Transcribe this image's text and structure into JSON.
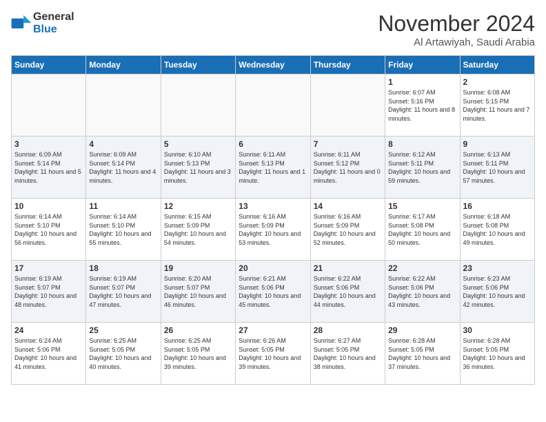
{
  "logo": {
    "text_general": "General",
    "text_blue": "Blue"
  },
  "title": "November 2024",
  "location": "Al Artawiyah, Saudi Arabia",
  "weekdays": [
    "Sunday",
    "Monday",
    "Tuesday",
    "Wednesday",
    "Thursday",
    "Friday",
    "Saturday"
  ],
  "weeks": [
    [
      {
        "day": "",
        "info": ""
      },
      {
        "day": "",
        "info": ""
      },
      {
        "day": "",
        "info": ""
      },
      {
        "day": "",
        "info": ""
      },
      {
        "day": "",
        "info": ""
      },
      {
        "day": "1",
        "info": "Sunrise: 6:07 AM\nSunset: 5:16 PM\nDaylight: 11 hours and 8 minutes."
      },
      {
        "day": "2",
        "info": "Sunrise: 6:08 AM\nSunset: 5:15 PM\nDaylight: 11 hours and 7 minutes."
      }
    ],
    [
      {
        "day": "3",
        "info": "Sunrise: 6:09 AM\nSunset: 5:14 PM\nDaylight: 11 hours and 5 minutes."
      },
      {
        "day": "4",
        "info": "Sunrise: 6:09 AM\nSunset: 5:14 PM\nDaylight: 11 hours and 4 minutes."
      },
      {
        "day": "5",
        "info": "Sunrise: 6:10 AM\nSunset: 5:13 PM\nDaylight: 11 hours and 3 minutes."
      },
      {
        "day": "6",
        "info": "Sunrise: 6:11 AM\nSunset: 5:13 PM\nDaylight: 11 hours and 1 minute."
      },
      {
        "day": "7",
        "info": "Sunrise: 6:11 AM\nSunset: 5:12 PM\nDaylight: 11 hours and 0 minutes."
      },
      {
        "day": "8",
        "info": "Sunrise: 6:12 AM\nSunset: 5:11 PM\nDaylight: 10 hours and 59 minutes."
      },
      {
        "day": "9",
        "info": "Sunrise: 6:13 AM\nSunset: 5:11 PM\nDaylight: 10 hours and 57 minutes."
      }
    ],
    [
      {
        "day": "10",
        "info": "Sunrise: 6:14 AM\nSunset: 5:10 PM\nDaylight: 10 hours and 56 minutes."
      },
      {
        "day": "11",
        "info": "Sunrise: 6:14 AM\nSunset: 5:10 PM\nDaylight: 10 hours and 55 minutes."
      },
      {
        "day": "12",
        "info": "Sunrise: 6:15 AM\nSunset: 5:09 PM\nDaylight: 10 hours and 54 minutes."
      },
      {
        "day": "13",
        "info": "Sunrise: 6:16 AM\nSunset: 5:09 PM\nDaylight: 10 hours and 53 minutes."
      },
      {
        "day": "14",
        "info": "Sunrise: 6:16 AM\nSunset: 5:09 PM\nDaylight: 10 hours and 52 minutes."
      },
      {
        "day": "15",
        "info": "Sunrise: 6:17 AM\nSunset: 5:08 PM\nDaylight: 10 hours and 50 minutes."
      },
      {
        "day": "16",
        "info": "Sunrise: 6:18 AM\nSunset: 5:08 PM\nDaylight: 10 hours and 49 minutes."
      }
    ],
    [
      {
        "day": "17",
        "info": "Sunrise: 6:19 AM\nSunset: 5:07 PM\nDaylight: 10 hours and 48 minutes."
      },
      {
        "day": "18",
        "info": "Sunrise: 6:19 AM\nSunset: 5:07 PM\nDaylight: 10 hours and 47 minutes."
      },
      {
        "day": "19",
        "info": "Sunrise: 6:20 AM\nSunset: 5:07 PM\nDaylight: 10 hours and 46 minutes."
      },
      {
        "day": "20",
        "info": "Sunrise: 6:21 AM\nSunset: 5:06 PM\nDaylight: 10 hours and 45 minutes."
      },
      {
        "day": "21",
        "info": "Sunrise: 6:22 AM\nSunset: 5:06 PM\nDaylight: 10 hours and 44 minutes."
      },
      {
        "day": "22",
        "info": "Sunrise: 6:22 AM\nSunset: 5:06 PM\nDaylight: 10 hours and 43 minutes."
      },
      {
        "day": "23",
        "info": "Sunrise: 6:23 AM\nSunset: 5:06 PM\nDaylight: 10 hours and 42 minutes."
      }
    ],
    [
      {
        "day": "24",
        "info": "Sunrise: 6:24 AM\nSunset: 5:06 PM\nDaylight: 10 hours and 41 minutes."
      },
      {
        "day": "25",
        "info": "Sunrise: 6:25 AM\nSunset: 5:05 PM\nDaylight: 10 hours and 40 minutes."
      },
      {
        "day": "26",
        "info": "Sunrise: 6:25 AM\nSunset: 5:05 PM\nDaylight: 10 hours and 39 minutes."
      },
      {
        "day": "27",
        "info": "Sunrise: 6:26 AM\nSunset: 5:05 PM\nDaylight: 10 hours and 39 minutes."
      },
      {
        "day": "28",
        "info": "Sunrise: 6:27 AM\nSunset: 5:05 PM\nDaylight: 10 hours and 38 minutes."
      },
      {
        "day": "29",
        "info": "Sunrise: 6:28 AM\nSunset: 5:05 PM\nDaylight: 10 hours and 37 minutes."
      },
      {
        "day": "30",
        "info": "Sunrise: 6:28 AM\nSunset: 5:05 PM\nDaylight: 10 hours and 36 minutes."
      }
    ]
  ]
}
